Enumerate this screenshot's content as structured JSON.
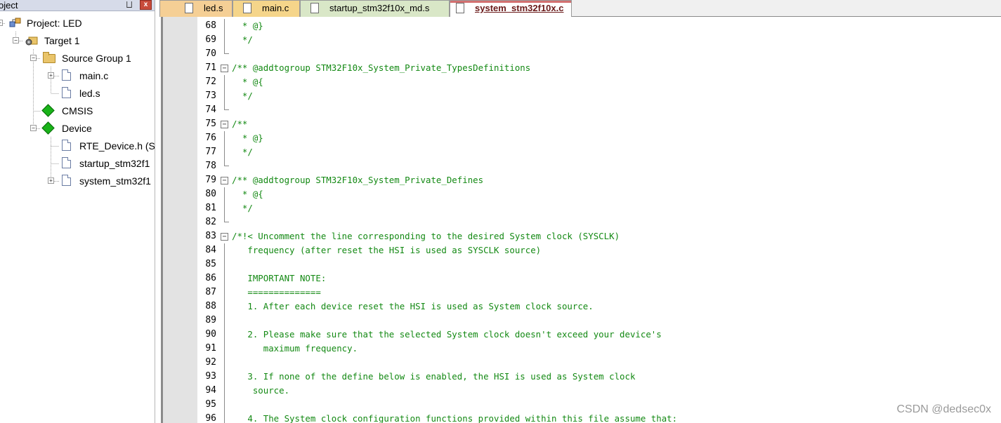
{
  "project_panel": {
    "title": "oject",
    "pin_glyph": "⨆",
    "close_glyph": "x",
    "tree": [
      {
        "label": "Project: LED",
        "icon": "project-icon",
        "expander": "-"
      },
      {
        "label": "Target 1",
        "icon": "target-icon",
        "expander": "-"
      },
      {
        "label": "Source Group 1",
        "icon": "folder-icon",
        "expander": "-"
      },
      {
        "label": "main.c",
        "icon": "file-icon",
        "expander": "+"
      },
      {
        "label": "led.s",
        "icon": "file-icon",
        "expander": ""
      },
      {
        "label": "CMSIS",
        "icon": "component-icon",
        "expander": ""
      },
      {
        "label": "Device",
        "icon": "component-icon",
        "expander": "-"
      },
      {
        "label": "RTE_Device.h (St",
        "icon": "file-icon",
        "expander": ""
      },
      {
        "label": "startup_stm32f1",
        "icon": "file-icon",
        "expander": ""
      },
      {
        "label": "system_stm32f1",
        "icon": "file-icon",
        "expander": "+"
      }
    ]
  },
  "tabs": [
    {
      "label": "led.s",
      "active": false,
      "color": "#f5cf95"
    },
    {
      "label": "main.c",
      "active": false,
      "color": "#f5d58a"
    },
    {
      "label": "startup_stm32f10x_md.s",
      "active": false,
      "color": "#d9e7c7"
    },
    {
      "label": "system_stm32f10x.c",
      "active": true,
      "color": "#ffffff"
    }
  ],
  "editor": {
    "code_color": "#138913",
    "lines": [
      {
        "no": "68",
        "text": "  * @}",
        "fold": "line"
      },
      {
        "no": "69",
        "text": "  */",
        "fold": "line"
      },
      {
        "no": "70",
        "text": "",
        "fold": "end"
      },
      {
        "no": "71",
        "text": "/** @addtogroup STM32F10x_System_Private_TypesDefinitions",
        "fold": "start"
      },
      {
        "no": "72",
        "text": "  * @{",
        "fold": "line"
      },
      {
        "no": "73",
        "text": "  */",
        "fold": "line"
      },
      {
        "no": "74",
        "text": "",
        "fold": "end"
      },
      {
        "no": "75",
        "text": "/**",
        "fold": "start"
      },
      {
        "no": "76",
        "text": "  * @}",
        "fold": "line"
      },
      {
        "no": "77",
        "text": "  */",
        "fold": "line"
      },
      {
        "no": "78",
        "text": "",
        "fold": "end"
      },
      {
        "no": "79",
        "text": "/** @addtogroup STM32F10x_System_Private_Defines",
        "fold": "start"
      },
      {
        "no": "80",
        "text": "  * @{",
        "fold": "line"
      },
      {
        "no": "81",
        "text": "  */",
        "fold": "line"
      },
      {
        "no": "82",
        "text": "",
        "fold": "end"
      },
      {
        "no": "83",
        "text": "/*!< Uncomment the line corresponding to the desired System clock (SYSCLK)",
        "fold": "start"
      },
      {
        "no": "84",
        "text": "   frequency (after reset the HSI is used as SYSCLK source)",
        "fold": "line"
      },
      {
        "no": "85",
        "text": "",
        "fold": "line"
      },
      {
        "no": "86",
        "text": "   IMPORTANT NOTE:",
        "fold": "line"
      },
      {
        "no": "87",
        "text": "   ==============",
        "fold": "line"
      },
      {
        "no": "88",
        "text": "   1. After each device reset the HSI is used as System clock source.",
        "fold": "line"
      },
      {
        "no": "89",
        "text": "",
        "fold": "line"
      },
      {
        "no": "90",
        "text": "   2. Please make sure that the selected System clock doesn't exceed your device's",
        "fold": "line"
      },
      {
        "no": "91",
        "text": "      maximum frequency.",
        "fold": "line"
      },
      {
        "no": "92",
        "text": "",
        "fold": "line"
      },
      {
        "no": "93",
        "text": "   3. If none of the define below is enabled, the HSI is used as System clock",
        "fold": "line"
      },
      {
        "no": "94",
        "text": "    source.",
        "fold": "line"
      },
      {
        "no": "95",
        "text": "",
        "fold": "line"
      },
      {
        "no": "96",
        "text": "   4. The System clock configuration functions provided within this file assume that:",
        "fold": "line"
      }
    ]
  },
  "watermark": "CSDN @dedsec0x"
}
